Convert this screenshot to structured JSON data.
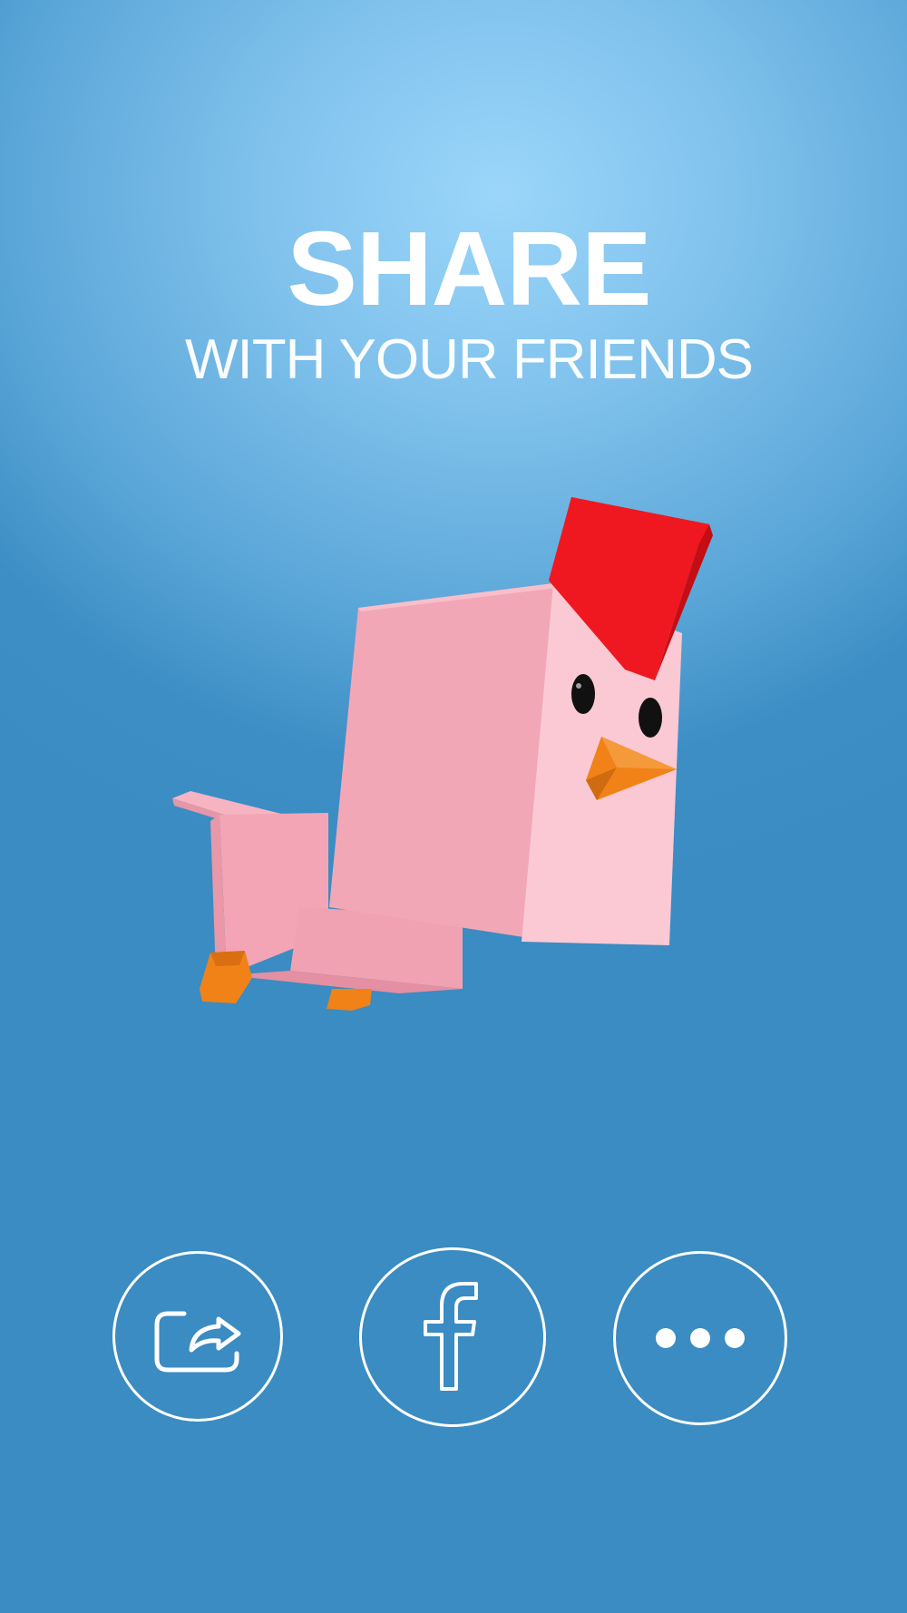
{
  "header": {
    "title": "SHARE",
    "subtitle": "WITH YOUR FRIENDS"
  },
  "mascot": {
    "icon": "chicken-mascot",
    "colors": {
      "body": "#f3a9b8",
      "face": "#fbc8d3",
      "comb": "#e6141c",
      "beak": "#f08218",
      "eye": "#111111"
    }
  },
  "share_buttons": [
    {
      "name": "share-button",
      "icon": "share-arrow-icon"
    },
    {
      "name": "facebook-button",
      "icon": "facebook-icon"
    },
    {
      "name": "more-button",
      "icon": "more-dots-icon"
    }
  ],
  "colors": {
    "background_top": "#9bd6fa",
    "background_bottom": "#3a8cc2",
    "foreground": "#ffffff"
  }
}
